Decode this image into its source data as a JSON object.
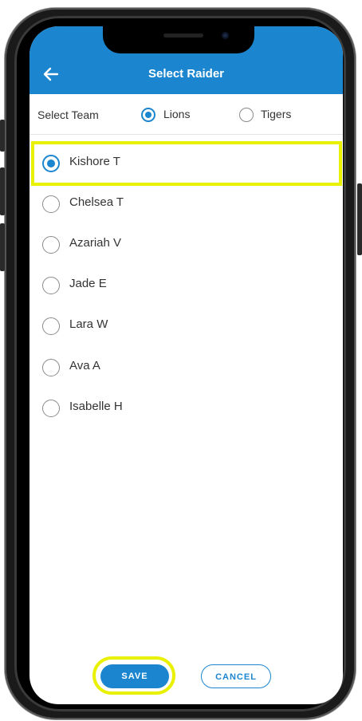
{
  "header": {
    "title": "Select Raider"
  },
  "team_selector": {
    "label": "Select Team",
    "options": [
      {
        "label": "Lions",
        "selected": true
      },
      {
        "label": "Tigers",
        "selected": false
      }
    ]
  },
  "players": [
    {
      "name": "Kishore T",
      "selected": true
    },
    {
      "name": "Chelsea T",
      "selected": false
    },
    {
      "name": "Azariah V",
      "selected": false
    },
    {
      "name": "Jade E",
      "selected": false
    },
    {
      "name": "Lara W",
      "selected": false
    },
    {
      "name": "Ava A",
      "selected": false
    },
    {
      "name": "Isabelle H",
      "selected": false
    }
  ],
  "actions": {
    "save_label": "SAVE",
    "cancel_label": "CANCEL"
  },
  "colors": {
    "primary": "#1b86cf",
    "highlight": "#e9f100"
  },
  "icons": {
    "back": "arrow-left-icon"
  }
}
